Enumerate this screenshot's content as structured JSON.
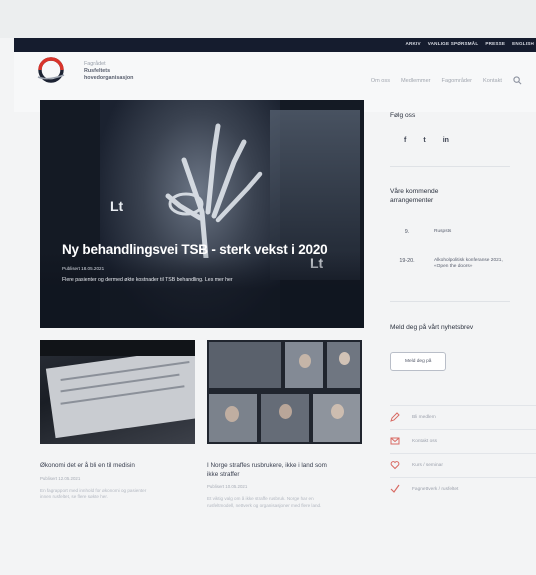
{
  "utility_nav": [
    "ARKIV",
    "VANLIGE SPØRSMÅL",
    "PRESSE",
    "ENGLISH"
  ],
  "brand": {
    "line1": "Fagrådet",
    "line2": "Rusfeltets",
    "line3": "hovedorganisasjon"
  },
  "main_nav": [
    "Om oss",
    "Medlemmer",
    "Fagområder",
    "Kontakt"
  ],
  "hero": {
    "title": "Ny behandlingsvei TSB - sterk vekst i 2020",
    "date": "Publisert 18.05.2021",
    "lead": "Flere pasienter og dermed økte kostnader til TSB behandling. Les mer her",
    "watermark": "Lt"
  },
  "sidebar": {
    "follow_title": "Følg oss",
    "social": [
      "f",
      "t",
      "in"
    ],
    "events_title": "Våre kommende arrangementer",
    "events": [
      {
        "date": "9.",
        "title": "Ruspsts"
      },
      {
        "date": "19-20.",
        "title": "Alkoholpolitisk konferanse 2021, «Open the doors»"
      }
    ],
    "newsletter_title": "Meld deg på vårt nyhetsbrev",
    "newsletter_button": "Meld deg på",
    "services": [
      "Bli medlem",
      "Kontakt oss",
      "Kurs / seminar",
      "Fagnettverk / rusfeltet"
    ]
  },
  "cards": [
    {
      "title": "Økonomi det er å bli en til medisin",
      "meta": "Publisert 12.05.2021",
      "text": "En fagrapport med innhold for økonomi og pasienter innen rusfeltet, se flere søkte her."
    },
    {
      "title": "I Norge straffes rusbrukere, ikke i land som ikke straffer",
      "meta": "Publisert 10.05.2021",
      "text": "Et viktig valg om å ikke straffe rusbruk. Norge har en rusfeltmodell, nettverk og organisasjoner med flere land."
    }
  ],
  "colors": {
    "utility_bar": "#151c2e",
    "logo_red": "#d9342b",
    "page_bg": "#f3f4f5",
    "accent": "#d86a63"
  }
}
